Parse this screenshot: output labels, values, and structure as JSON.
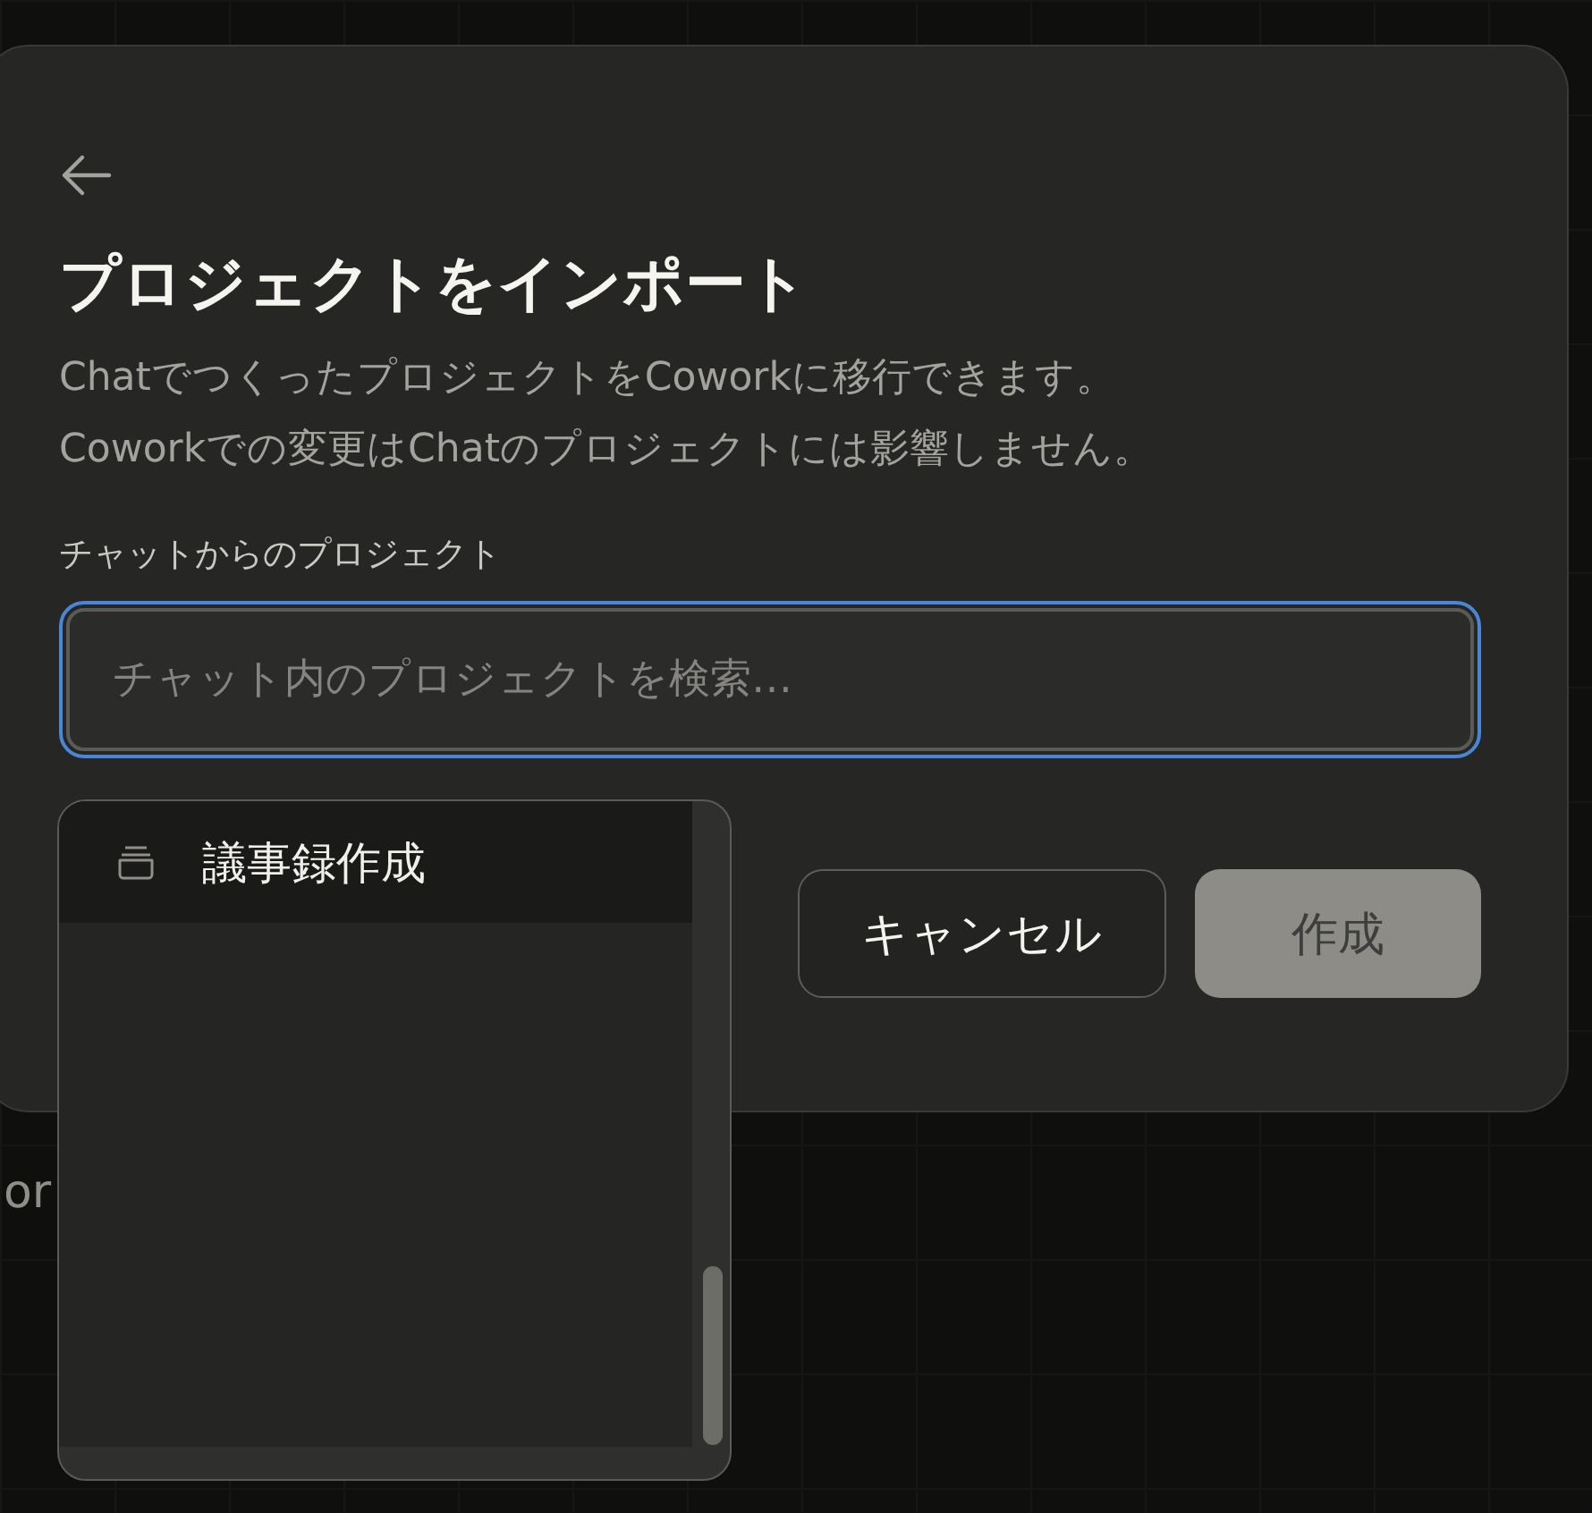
{
  "background": {
    "text": "or"
  },
  "dialog": {
    "title": "プロジェクトをインポート",
    "description": [
      "ChatでつくったプロジェクトをCoworkに移行できます。",
      "Coworkでの変更はChatのプロジェクトには影響しません。"
    ],
    "search": {
      "label": "チャットからのプロジェクト",
      "placeholder": "チャット内のプロジェクトを検索…",
      "focused": true
    },
    "buttons": [
      {
        "label": "キャンセル",
        "kind": "secondary",
        "disabled": false
      },
      {
        "label": "作成",
        "kind": "primary",
        "disabled": true
      }
    ]
  },
  "dropdown": {
    "items": [
      {
        "label": "議事録作成",
        "selected": true
      }
    ]
  }
}
